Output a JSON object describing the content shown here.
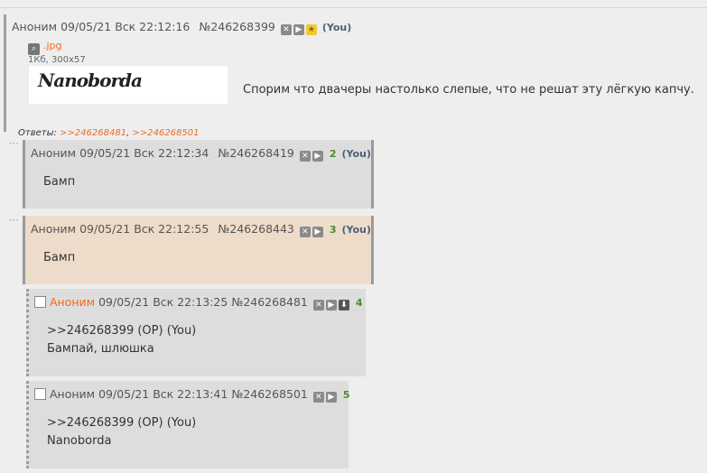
{
  "op": {
    "name": "Аноним",
    "date": "09/05/21 Вск 22:12:16",
    "num": "№246268399",
    "you": "(You)",
    "file_ext": ".jpg",
    "file_meta": "1Кб, 300x57",
    "captcha_text": "Nanoborda",
    "text": "Спорим что двачеры настолько слепые, что не решат эту лёгкую капчу.",
    "replies_label": "Ответы:",
    "reply_links": [
      ">>246268481",
      ">>246268501"
    ]
  },
  "posts": [
    {
      "name": "Аноним",
      "date": "09/05/21 Вск 22:12:34",
      "num": "№246268419",
      "count": "2",
      "you": "(You)",
      "text": "Бамп"
    },
    {
      "name": "Аноним",
      "date": "09/05/21 Вск 22:12:55",
      "num": "№246268443",
      "count": "3",
      "you": "(You)",
      "text": "Бамп"
    },
    {
      "name": "Аноним",
      "date": "09/05/21 Вск 22:13:25",
      "num": "№246268481",
      "count": "4",
      "quote": ">>246268399 (OP) (You)",
      "text": "Бампай, шлюшка"
    },
    {
      "name": "Аноним",
      "date": "09/05/21 Вск 22:13:41",
      "num": "№246268501",
      "count": "5",
      "quote": ">>246268399 (OP) (You)",
      "text": "Nanoborda"
    }
  ],
  "icons": {
    "hide": "hide-icon",
    "play": "play-icon",
    "star": "star-icon",
    "download": "download-icon",
    "search": "search-icon"
  }
}
